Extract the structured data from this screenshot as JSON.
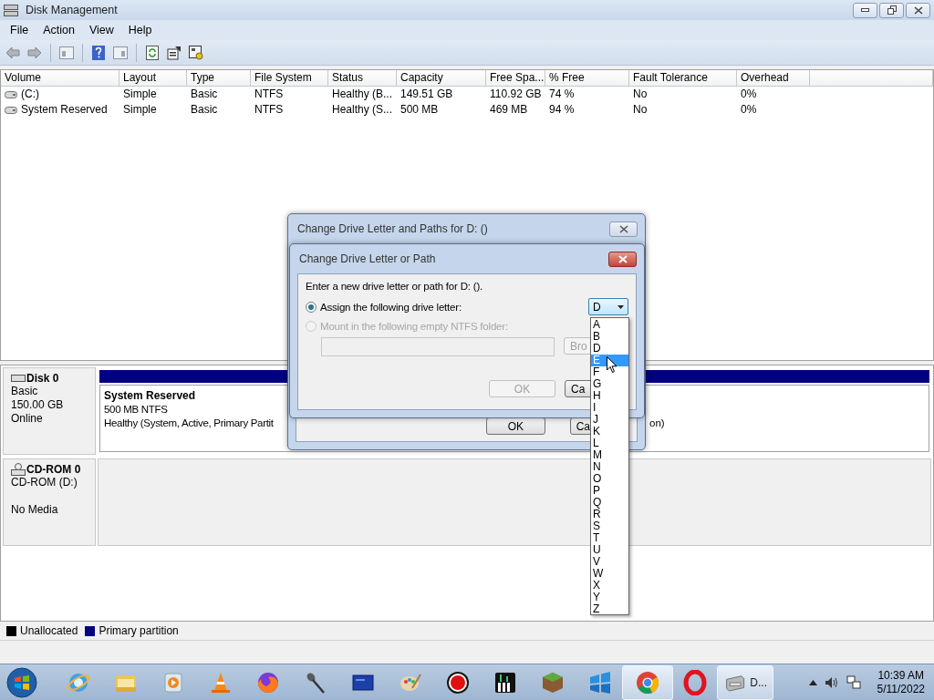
{
  "window": {
    "title": "Disk Management"
  },
  "menu": [
    "File",
    "Action",
    "View",
    "Help"
  ],
  "volumes": {
    "columns": [
      "Volume",
      "Layout",
      "Type",
      "File System",
      "Status",
      "Capacity",
      "Free Spa...",
      "% Free",
      "Fault Tolerance",
      "Overhead"
    ],
    "rows": [
      {
        "cells": [
          "(C:)",
          "Simple",
          "Basic",
          "NTFS",
          "Healthy (B...",
          "149.51 GB",
          "110.92 GB",
          "74 %",
          "No",
          "0%"
        ]
      },
      {
        "cells": [
          "System Reserved",
          "Simple",
          "Basic",
          "NTFS",
          "Healthy (S...",
          "500 MB",
          "469 MB",
          "94 %",
          "No",
          "0%"
        ]
      }
    ]
  },
  "disks": [
    {
      "kind": "disk",
      "name": "Disk 0",
      "lines": [
        "Basic",
        "150.00 GB",
        "Online"
      ],
      "partition": {
        "title": "System Reserved",
        "size": "500 MB NTFS",
        "status": "Healthy (System, Active, Primary Partit",
        "status_tail": "on)"
      }
    },
    {
      "kind": "cdrom",
      "name": "CD-ROM 0",
      "lines": [
        "CD-ROM (D:)",
        "No Media"
      ]
    }
  ],
  "legend": [
    {
      "label": "Unallocated",
      "color": "#000000"
    },
    {
      "label": "Primary partition",
      "color": "#000080"
    }
  ],
  "paths_dialog": {
    "title": "Change Drive Letter and Paths for D: ()",
    "buttons": [
      "OK",
      "Ca"
    ]
  },
  "letter_dialog": {
    "title": "Change Drive Letter or Path",
    "prompt": "Enter a new drive letter or path for D: ().",
    "options": [
      {
        "label": "Assign the following drive letter:",
        "selected": true,
        "disabled": false
      },
      {
        "label": "Mount in the following empty NTFS folder:",
        "selected": false,
        "disabled": true
      }
    ],
    "drive_letter": "D",
    "browse": "Bro",
    "buttons": [
      {
        "label": "OK",
        "disabled": true
      },
      {
        "label": "Ca",
        "disabled": false
      }
    ]
  },
  "letter_list": [
    {
      "label": "A",
      "selected": false
    },
    {
      "label": "B",
      "selected": false
    },
    {
      "label": "D",
      "selected": false
    },
    {
      "label": "E",
      "selected": true
    },
    {
      "label": "F",
      "selected": false
    },
    {
      "label": "G",
      "selected": false
    },
    {
      "label": "H",
      "selected": false
    },
    {
      "label": "I",
      "selected": false
    },
    {
      "label": "J",
      "selected": false
    },
    {
      "label": "K",
      "selected": false
    },
    {
      "label": "L",
      "selected": false
    },
    {
      "label": "M",
      "selected": false
    },
    {
      "label": "N",
      "selected": false
    },
    {
      "label": "O",
      "selected": false
    },
    {
      "label": "P",
      "selected": false
    },
    {
      "label": "Q",
      "selected": false
    },
    {
      "label": "R",
      "selected": false
    },
    {
      "label": "S",
      "selected": false
    },
    {
      "label": "T",
      "selected": false
    },
    {
      "label": "U",
      "selected": false
    },
    {
      "label": "V",
      "selected": false
    },
    {
      "label": "W",
      "selected": false
    },
    {
      "label": "X",
      "selected": false
    },
    {
      "label": "Y",
      "selected": false
    },
    {
      "label": "Z",
      "selected": false
    }
  ],
  "taskbar": {
    "apps": [
      {
        "kind": "globe-e",
        "active": false
      },
      {
        "kind": "folder",
        "active": false
      },
      {
        "kind": "player",
        "active": false
      },
      {
        "kind": "cone",
        "active": false
      },
      {
        "kind": "fox",
        "active": false
      },
      {
        "kind": "mic",
        "active": false
      },
      {
        "kind": "monitor",
        "active": false
      },
      {
        "kind": "palette",
        "active": false
      },
      {
        "kind": "record",
        "active": false
      },
      {
        "kind": "piano",
        "active": false
      },
      {
        "kind": "cube",
        "active": false
      },
      {
        "kind": "flag",
        "active": false
      },
      {
        "kind": "wheel",
        "active": true
      },
      {
        "kind": "ring",
        "active": false
      },
      {
        "kind": "drive",
        "active": true,
        "label": "D..."
      }
    ],
    "time": "10:39 AM",
    "date": "5/11/2022"
  }
}
